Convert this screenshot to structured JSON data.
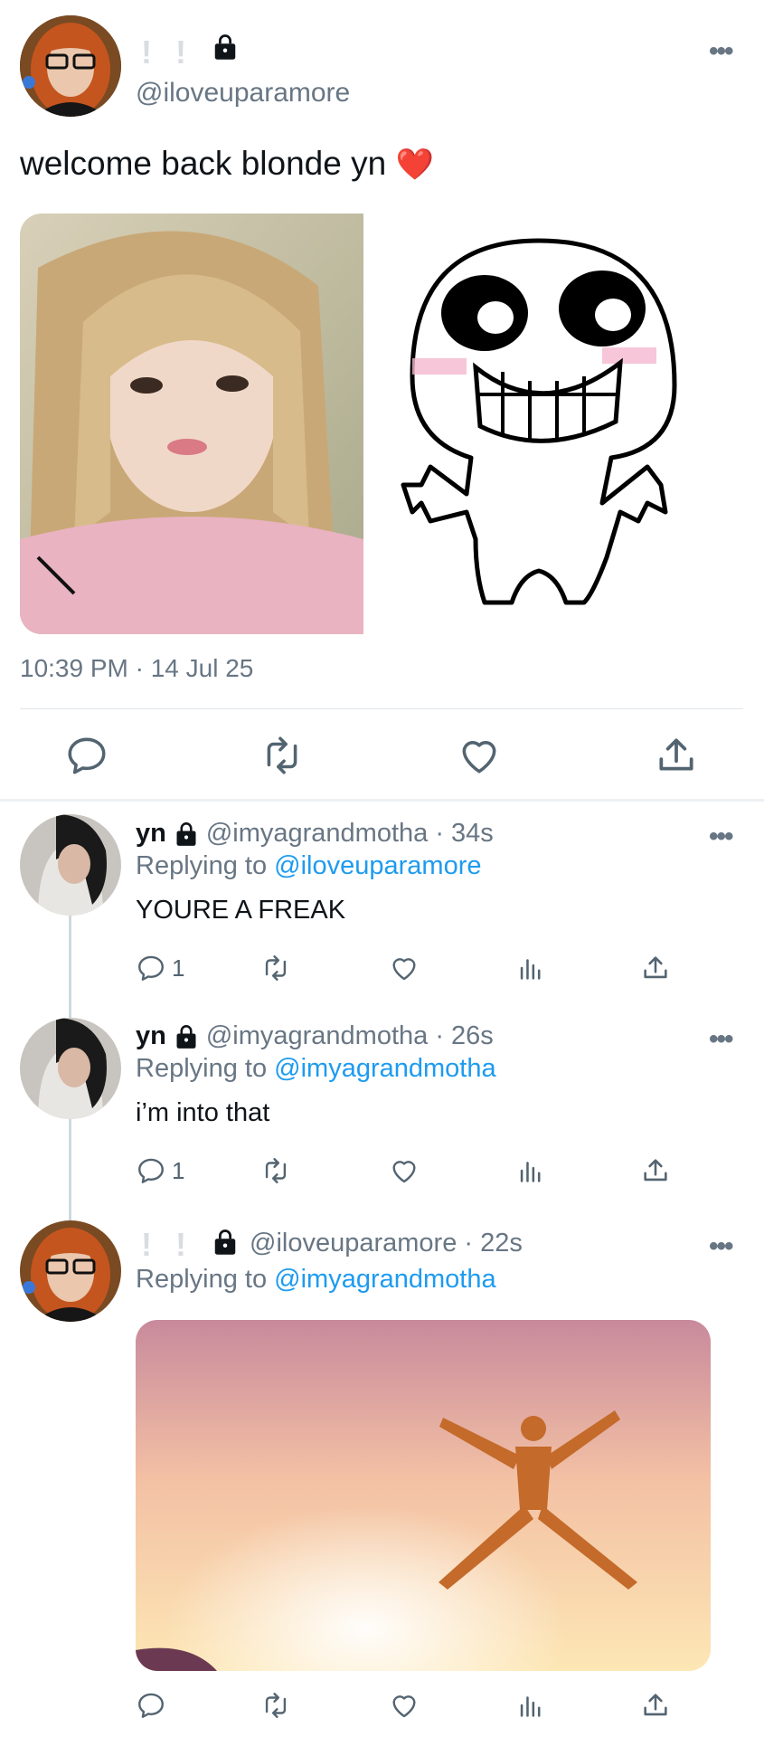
{
  "main_tweet": {
    "display_name_marks": [
      "!",
      "!"
    ],
    "handle": "@iloveuparamore",
    "text": "welcome back blonde yn",
    "emoji": "❤️",
    "timestamp": "10:39 PM · 14 Jul 25",
    "more": "•••"
  },
  "replies": [
    {
      "name": "yn",
      "handle_time": "@imyagrandmotha · 34s",
      "replying_prefix": "Replying to",
      "replying_to": "@iloveuparamore",
      "text": "YOURE A FREAK",
      "reply_count": "1",
      "more": "•••"
    },
    {
      "name": "yn",
      "handle_time": "@imyagrandmotha · 26s",
      "replying_prefix": "Replying to",
      "replying_to": "@imyagrandmotha",
      "text": "i’m into that",
      "reply_count": "1",
      "more": "•••"
    },
    {
      "name_marks": [
        "!",
        "!"
      ],
      "handle_time": "@iloveuparamore · 22s",
      "replying_prefix": "Replying to",
      "replying_to": "@imyagrandmotha",
      "more": "•••"
    }
  ],
  "icons": {
    "reply": "reply-icon",
    "retweet": "retweet-icon",
    "like": "heart-icon",
    "views": "views-icon",
    "share": "share-icon",
    "lock": "lock-icon"
  },
  "colors": {
    "link": "#1d9bf0",
    "muted": "#687684",
    "heart": "#e0245e"
  }
}
